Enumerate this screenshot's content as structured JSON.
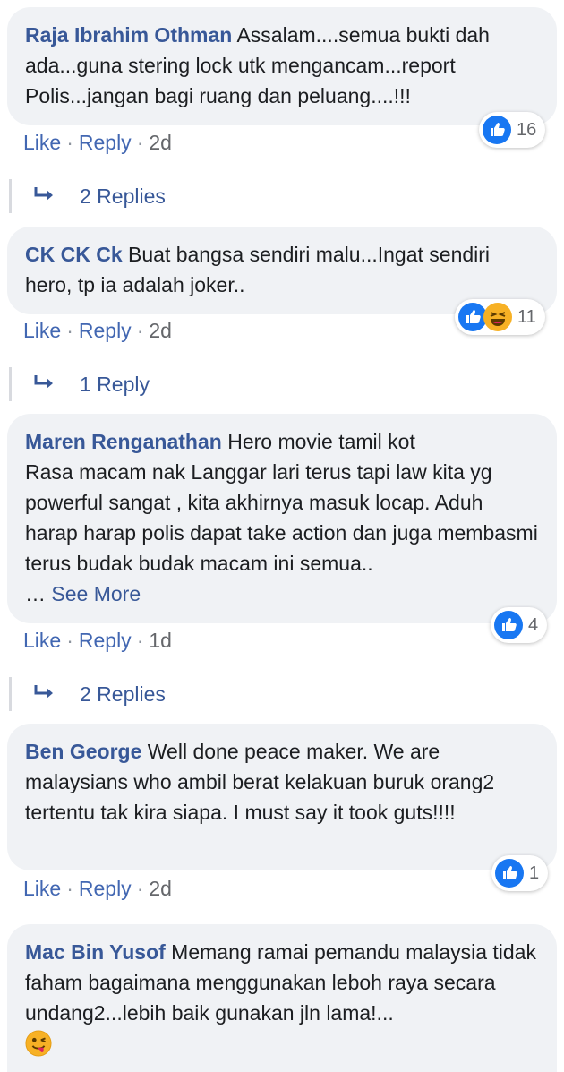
{
  "comments": [
    {
      "author": "Raja Ibrahim Othman",
      "text": "Assalam....semua bukti dah ada...guna stering lock utk mengancam...report Polis...jangan bagi ruang dan peluang....!!!",
      "reaction_count": "16",
      "like": "Like",
      "reply": "Reply",
      "time": "2d",
      "replies": "2 Replies"
    },
    {
      "author": "CK CK Ck",
      "text": "Buat bangsa sendiri malu...Ingat sendiri hero, tp ia adalah joker..",
      "reaction_count": "11",
      "like": "Like",
      "reply": "Reply",
      "time": "2d",
      "replies": "1 Reply"
    },
    {
      "author": "Maren Renganathan",
      "text_lines": [
        "Hero movie tamil kot",
        "Rasa macam nak Langgar lari terus tapi law kita yg powerful sangat , kita akhirnya masuk locap. Aduh harap harap polis dapat take action dan juga membasmi terus budak budak macam ini semua.."
      ],
      "see_more_prefix": "…",
      "see_more": "See More",
      "reaction_count": "4",
      "like": "Like",
      "reply": "Reply",
      "time": "1d",
      "replies": "2 Replies"
    },
    {
      "author": "Ben George",
      "text": "Well done peace maker. We are malaysians who ambil berat kelakuan buruk orang2 tertentu tak kira siapa. I must say it took guts!!!!",
      "reaction_count": "1",
      "like": "Like",
      "reply": "Reply",
      "time": "2d"
    },
    {
      "author": "Mac Bin Yusof",
      "text": "Memang ramai pemandu malaysia tidak faham bagaimana menggunakan leboh raya secara undang2...lebih baik gunakan jln lama!...",
      "emoji": "winking-tongue-emoji"
    }
  ],
  "separator": "·",
  "colors": {
    "author": "#385898",
    "link": "#4267b2",
    "bubble": "#f0f2f5",
    "like_blue": "#1877f2",
    "haha_yellow": "#f7b125"
  }
}
